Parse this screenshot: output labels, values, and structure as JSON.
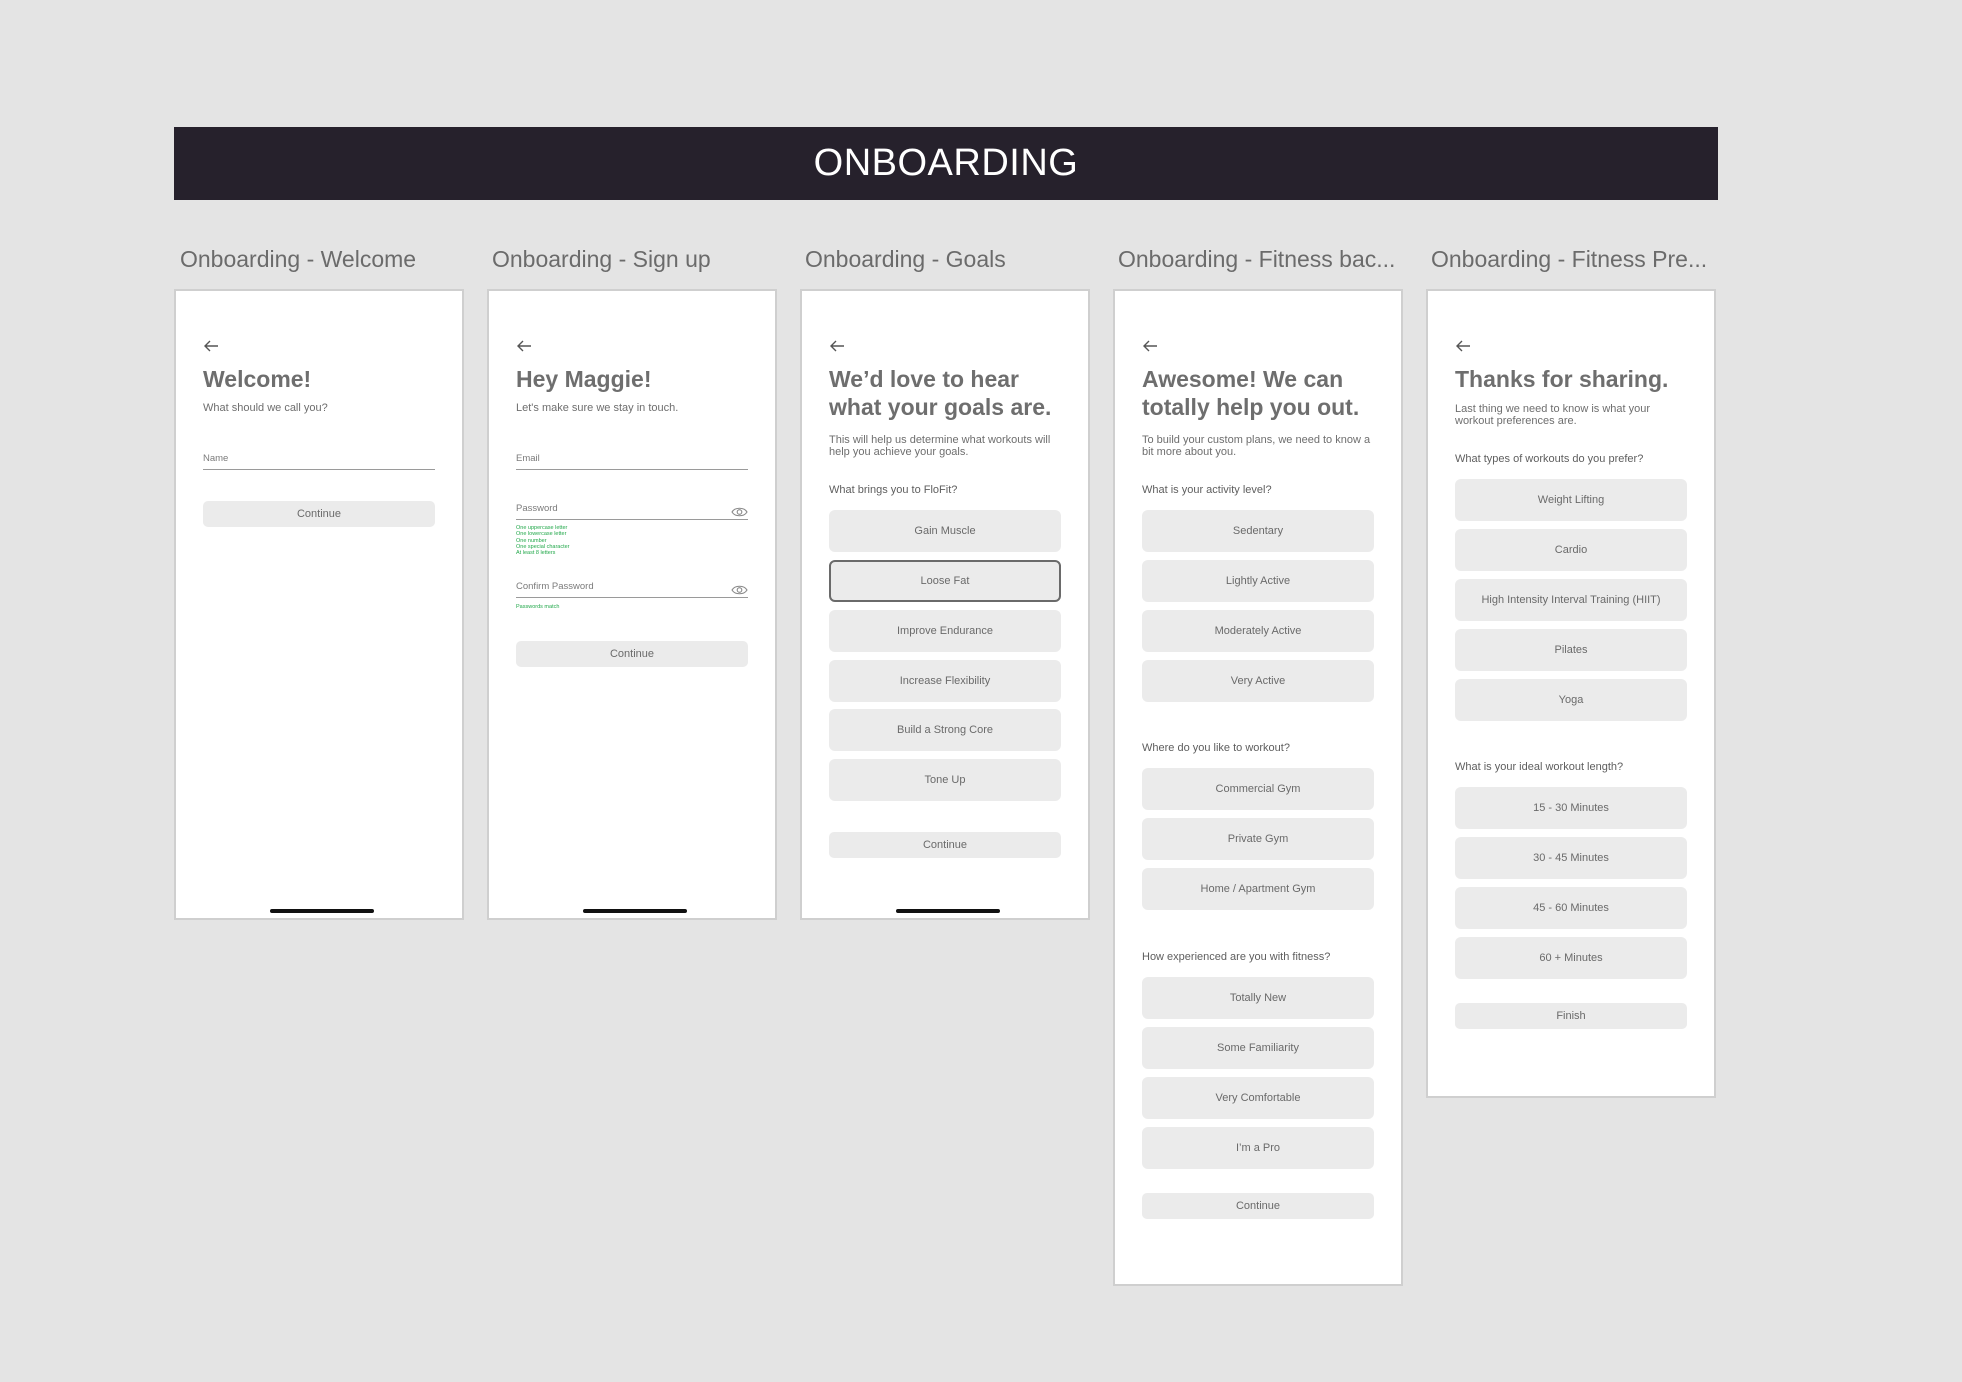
{
  "banner": {
    "title": "ONBOARDING"
  },
  "colors": {
    "banner_bg": "#26212c",
    "canvas_bg": "#e4e4e4",
    "hint_green": "#22a84a"
  },
  "frames": {
    "welcome": {
      "label": "Onboarding - Welcome",
      "title": "Welcome!",
      "subtitle": "What should we call you?",
      "name_placeholder": "Name",
      "continue": "Continue"
    },
    "signup": {
      "label": "Onboarding - Sign up",
      "title": "Hey Maggie!",
      "subtitle": "Let's make sure we stay in touch.",
      "email_placeholder": "Email",
      "password_placeholder": "Password",
      "password_hints": [
        "One uppercase letter",
        "One lowercase letter",
        "One number",
        "One special character",
        "At least 8 letters"
      ],
      "confirm_placeholder": "Confirm Password",
      "match_hint": "Passwords match",
      "continue": "Continue"
    },
    "goals": {
      "label": "Onboarding - Goals",
      "title": "We’d love to hear what your goals are.",
      "subtitle": "This will help us determine what workouts will help you achieve your goals.",
      "question": "What brings you to FloFit?",
      "options": [
        "Gain Muscle",
        "Loose Fat",
        "Improve Endurance",
        "Increase Flexibility",
        "Build a Strong Core",
        "Tone Up"
      ],
      "selected": "Loose Fat",
      "continue": "Continue"
    },
    "background": {
      "label": "Onboarding - Fitness bac...",
      "title": "Awesome! We can totally help you out.",
      "subtitle": "To build your custom plans, we need to know a bit more about you.",
      "q1": "What is your activity level?",
      "activity": [
        "Sedentary",
        "Lightly Active",
        "Moderately Active",
        "Very Active"
      ],
      "q2": "Where do you like to workout?",
      "location": [
        "Commercial Gym",
        "Private Gym",
        "Home / Apartment Gym"
      ],
      "q3": "How experienced are you with fitness?",
      "experience": [
        "Totally New",
        "Some Familiarity",
        "Very Comfortable",
        "I’m a Pro"
      ],
      "continue": "Continue"
    },
    "preferences": {
      "label": "Onboarding - Fitness Pre...",
      "title": "Thanks for sharing.",
      "subtitle": "Last thing we need to know is what your workout preferences are.",
      "q1": "What types of workouts do you prefer?",
      "types": [
        "Weight Lifting",
        "Cardio",
        "High Intensity Interval Training (HIIT)",
        "Pilates",
        "Yoga"
      ],
      "q2": "What is your ideal workout length?",
      "lengths": [
        "15 - 30 Minutes",
        "30 - 45 Minutes",
        "45 - 60 Minutes",
        "60 + Minutes"
      ],
      "finish": "Finish"
    }
  }
}
